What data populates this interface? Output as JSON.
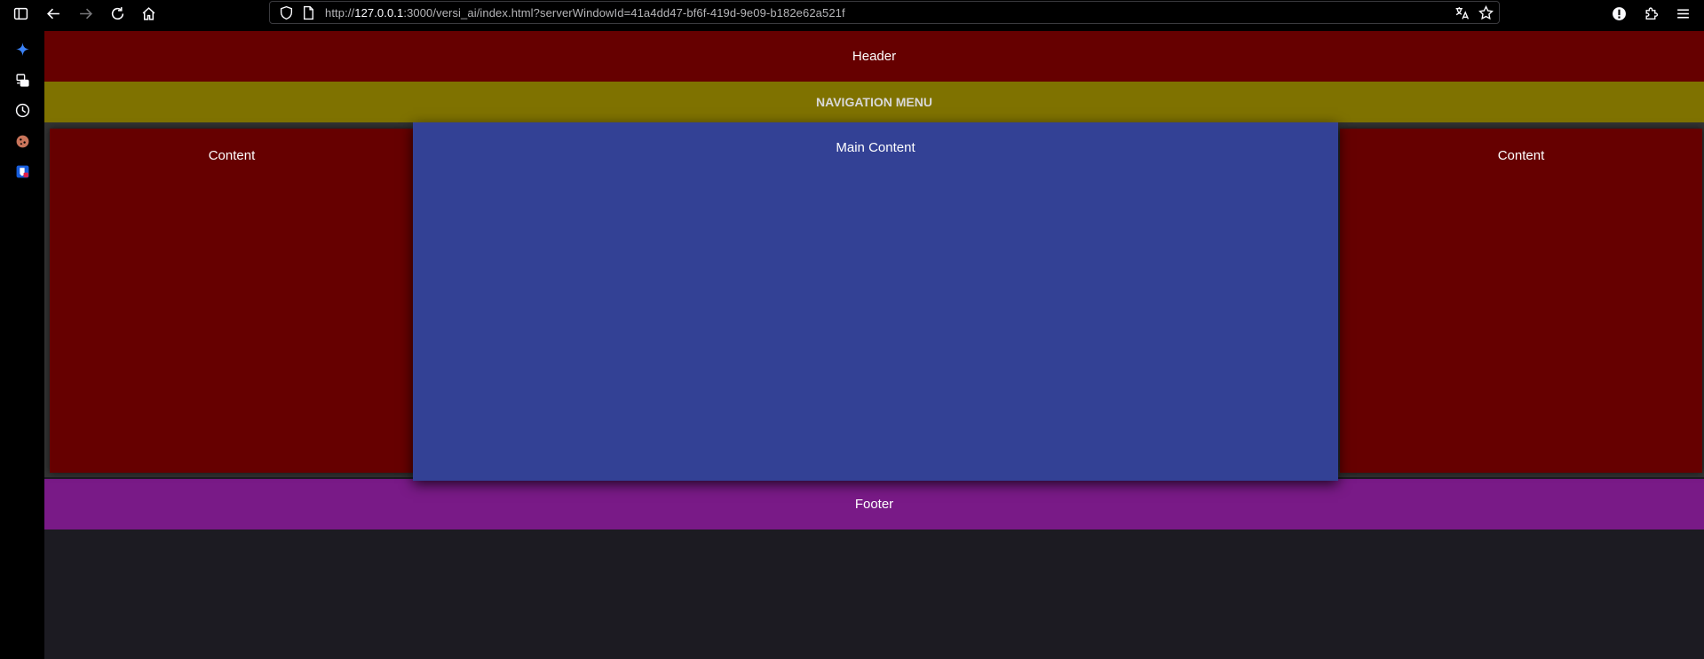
{
  "browser": {
    "url_prefix": "http://",
    "url_host": "127.0.0.1",
    "url_rest": ":3000/versi_ai/index.html?serverWindowId=41a4dd47-bf6f-419d-9e09-b182e62a521f",
    "accent_color": "#3b82f6"
  },
  "page": {
    "header": "Header",
    "nav": "NAVIGATION MENU",
    "left_sidebar": "Content",
    "main": "Main Content",
    "right_sidebar": "Content",
    "footer": "Footer",
    "colors": {
      "header": "#660000",
      "nav": "#7f7200",
      "main": "#334195",
      "sidebar": "#660000",
      "footer": "#791a87",
      "background": "#1c1b22"
    }
  }
}
